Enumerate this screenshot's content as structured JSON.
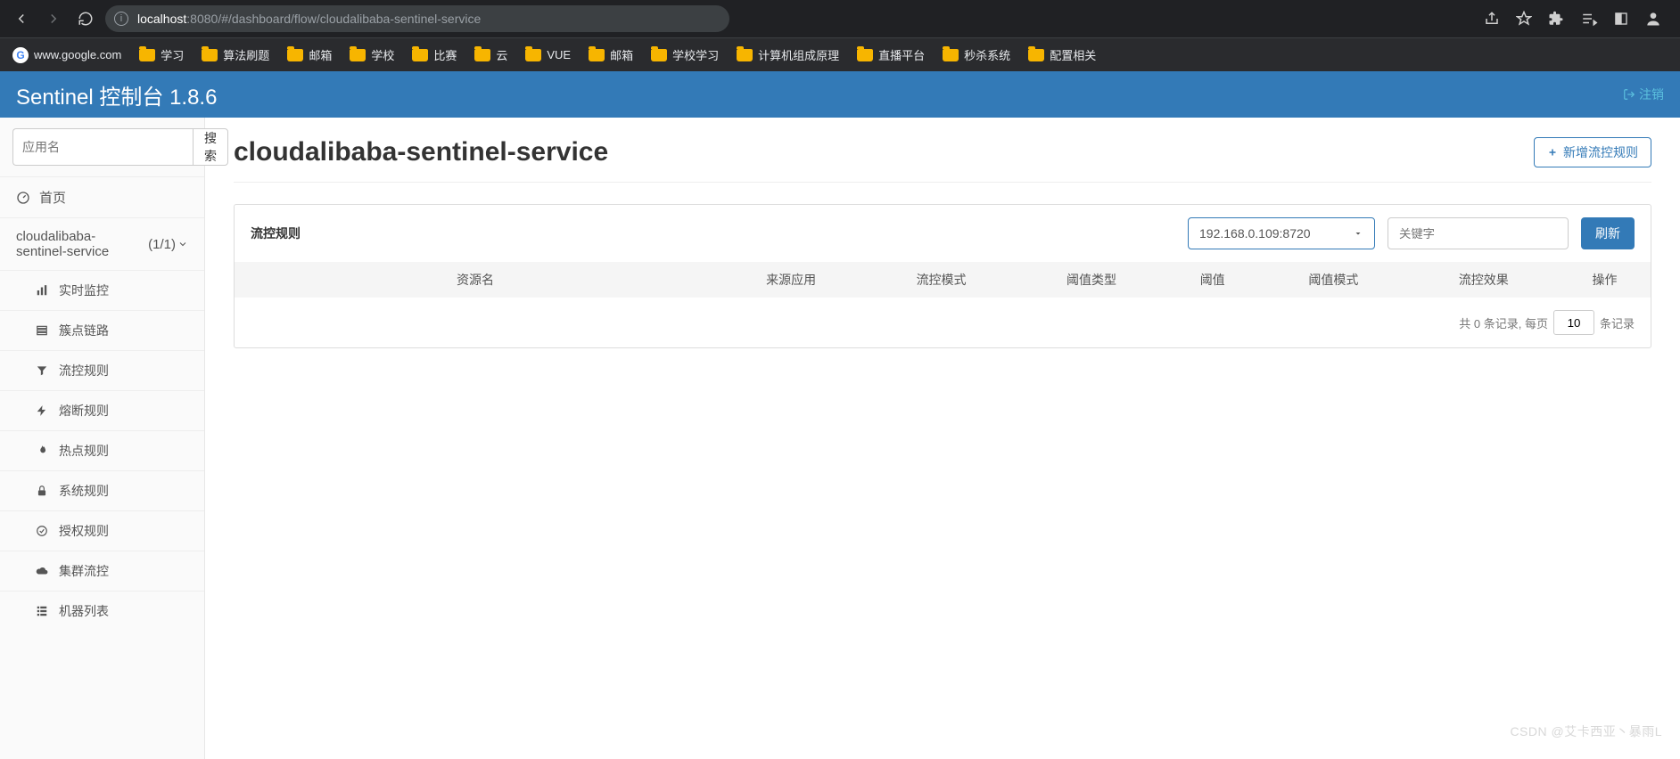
{
  "browser": {
    "url_host": "localhost",
    "url_port": ":8080",
    "url_path": "/#/dashboard/flow/cloudalibaba-sentinel-service"
  },
  "bookmarks": {
    "google": "www.google.com",
    "items": [
      "学习",
      "算法刷题",
      "邮箱",
      "学校",
      "比赛",
      "云",
      "VUE",
      "邮箱",
      "学校学习",
      "计算机组成原理",
      "直播平台",
      "秒杀系统",
      "配置相关"
    ]
  },
  "header": {
    "title": "Sentinel 控制台 1.8.6",
    "logout": "注销"
  },
  "sidebar": {
    "search_placeholder": "应用名",
    "search_btn": "搜索",
    "home": "首页",
    "app_name": "cloudalibaba-sentinel-service",
    "app_count": "(1/1)",
    "menu": {
      "realtime": "实时监控",
      "cluster_link": "簇点链路",
      "flow": "流控规则",
      "degrade": "熔断规则",
      "hotspot": "热点规则",
      "system": "系统规则",
      "authority": "授权规则",
      "cluster_flow": "集群流控",
      "machines": "机器列表"
    }
  },
  "page": {
    "title": "cloudalibaba-sentinel-service",
    "add_button": "新增流控规则"
  },
  "panel": {
    "title": "流控规则",
    "ip_selected": "192.168.0.109:8720",
    "keyword_placeholder": "关键字",
    "refresh": "刷新",
    "columns": {
      "resource": "资源名",
      "origin": "来源应用",
      "mode": "流控模式",
      "threshold_type": "阈值类型",
      "threshold": "阈值",
      "threshold_mode": "阈值模式",
      "effect": "流控效果",
      "ops": "操作"
    },
    "pager_prefix": "共 0 条记录, 每页",
    "pager_value": "10",
    "pager_suffix": "条记录"
  },
  "watermark": "CSDN @艾卡西亚丶暴雨L"
}
